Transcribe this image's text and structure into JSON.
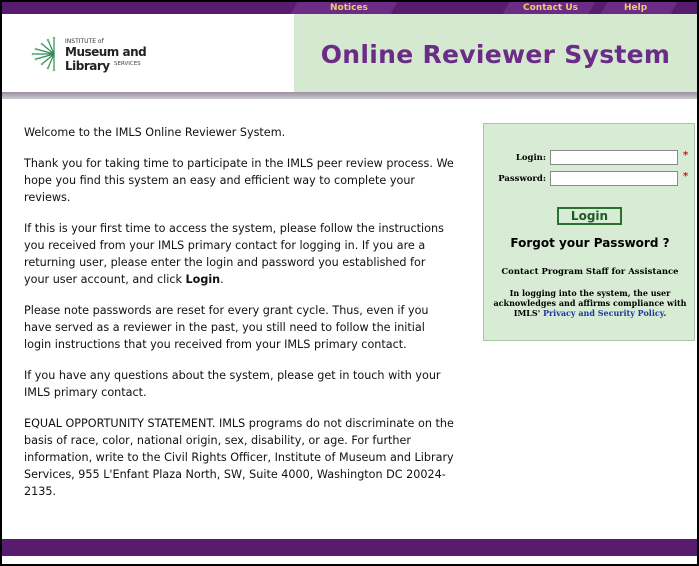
{
  "nav": {
    "notices": "Notices",
    "contact_us": "Contact Us",
    "help": "Help"
  },
  "logo": {
    "line1": "INSTITUTE of",
    "line2": "Museum and Library",
    "line3": "SERVICES"
  },
  "header": {
    "title": "Online Reviewer System"
  },
  "content": {
    "p1": "Welcome to the IMLS Online Reviewer System.",
    "p2": "Thank you for taking time to participate in the IMLS peer review process. We hope you find this system an easy and efficient way to complete your reviews.",
    "p3_before": "If this is your first time to access the system, please follow the instructions you received from your IMLS primary contact for logging in. If you are a returning user, please enter the login and password you established for your user account, and click ",
    "p3_bold": "Login",
    "p3_after": ".",
    "p4": "Please note passwords are reset for every grant cycle. Thus, even if you have served as a reviewer in the past, you still need to follow the initial login instructions that you received from your IMLS primary contact.",
    "p5": "If you have any questions about the system, please get in touch with your IMLS primary contact.",
    "p6": "EQUAL OPPORTUNITY STATEMENT. IMLS programs do not discriminate on the basis of race, color, national origin, sex, disability, or age. For further information, write to the Civil Rights Officer, Institute of Museum and Library Services, 955 L'Enfant Plaza North, SW, Suite 4000, Washington DC 20024-2135."
  },
  "login": {
    "login_label": "Login:",
    "password_label": "Password:",
    "login_value": "",
    "password_value": "",
    "required_mark": "*",
    "button_label": "Login",
    "forgot": "Forgot your Password ?",
    "contact": "Contact Program Staff for Assistance",
    "notice_before": "In logging into the system, the user acknowledges and affirms compliance with IMLS' ",
    "notice_link": "Privacy and Security Policy",
    "notice_after": "."
  },
  "colors": {
    "brand_purple": "#581c6e",
    "title_purple": "#6a2c86",
    "panel_green": "#d8ecd5",
    "nav_gold": "#f1cb6a"
  }
}
